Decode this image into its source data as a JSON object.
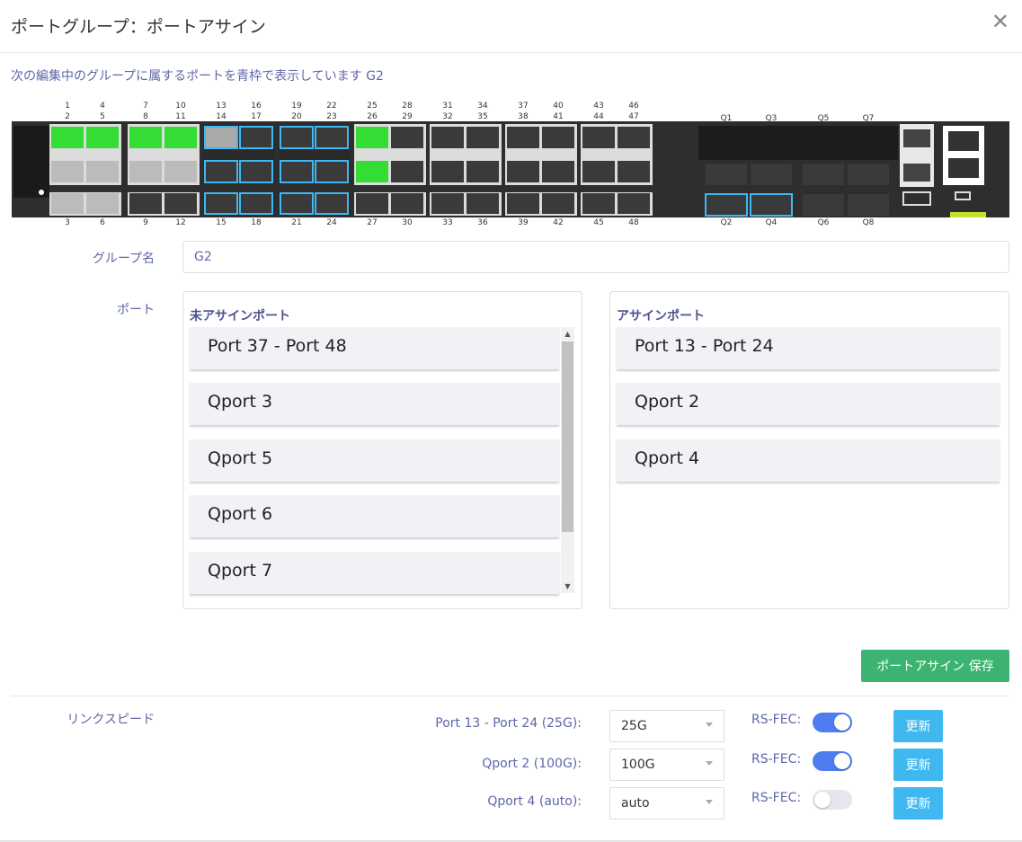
{
  "dialog": {
    "title": "ポートグループ：ポートアサイン",
    "hint": "次の編集中のグループに属するポートを青枠で表示しています G2"
  },
  "device": {
    "top_numbers": [
      "1",
      "2",
      "4",
      "5",
      "7",
      "8",
      "10",
      "11",
      "13",
      "14",
      "16",
      "17",
      "19",
      "20",
      "22",
      "23",
      "25",
      "26",
      "28",
      "29",
      "31",
      "32",
      "34",
      "35",
      "37",
      "38",
      "40",
      "41",
      "43",
      "44",
      "46",
      "47"
    ],
    "bottom_numbers": [
      "3",
      "6",
      "9",
      "12",
      "15",
      "18",
      "21",
      "24",
      "27",
      "30",
      "33",
      "36",
      "39",
      "42",
      "45",
      "48"
    ],
    "qsfp_top": [
      "Q1",
      "Q3",
      "Q5",
      "Q7"
    ],
    "qsfp_bottom": [
      "Q2",
      "Q4",
      "Q6",
      "Q8"
    ],
    "colors": {
      "chassis": "#2b2b2b",
      "bay": "#dcdcdc",
      "highlight": "#3eb7f2",
      "active": "#33dd33",
      "accent": "#c8e02e"
    }
  },
  "group": {
    "label": "グループ名",
    "value": "G2"
  },
  "ports": {
    "label": "ポート",
    "unassigned_title": "未アサインポート",
    "assigned_title": "アサインポート",
    "unassigned": [
      "Port 37 - Port 48",
      "Qport 3",
      "Qport 5",
      "Qport 6",
      "Qport 7"
    ],
    "assigned": [
      "Port 13 - Port 24",
      "Qport 2",
      "Qport 4"
    ]
  },
  "save_button": "ポートアサイン 保存",
  "link_speed": {
    "label": "リンクスピード",
    "fec_label": "RS-FEC:",
    "update_label": "更新",
    "rows": [
      {
        "port": "Port 13 - Port 24 (25G):",
        "speed": "25G",
        "fec": true
      },
      {
        "port": "Qport 2 (100G):",
        "speed": "100G",
        "fec": true
      },
      {
        "port": "Qport 4 (auto):",
        "speed": "auto",
        "fec": false
      }
    ]
  }
}
